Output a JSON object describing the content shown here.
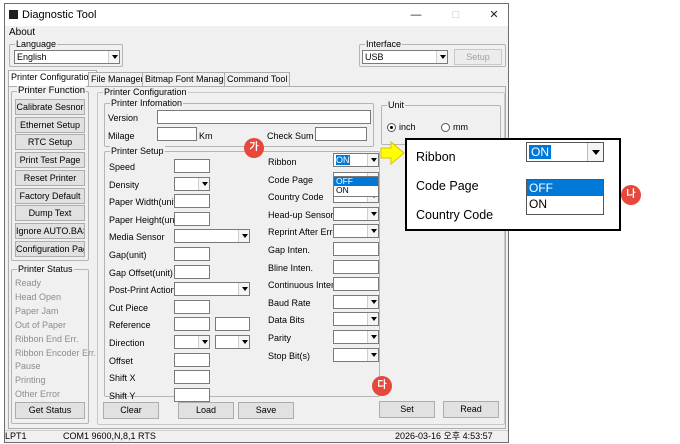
{
  "window": {
    "title": "Diagnostic Tool",
    "controls": {
      "minimize": "—",
      "maximize": "□",
      "close": "✕"
    }
  },
  "menu": {
    "about": "About"
  },
  "language": {
    "label": "Language",
    "value": "English"
  },
  "interface": {
    "label": "Interface",
    "value": "USB",
    "setup_button": "Setup"
  },
  "tabs": [
    "Printer Configuration",
    "File Manager",
    "Bitmap Font Manager",
    "Command Tool"
  ],
  "printer_function": {
    "label": "Printer Function",
    "buttons": [
      "Calibrate Sesnor",
      "Ethernet Setup",
      "RTC Setup",
      "Print Test Page",
      "Reset Printer",
      "Factory Default",
      "Dump Text",
      "Ignore AUTO.BAS",
      "Configuration Page"
    ]
  },
  "printer_status": {
    "label": "Printer Status",
    "items": [
      "Ready",
      "Head Open",
      "Paper Jam",
      "Out of Paper",
      "Ribbon End Err.",
      "Ribbon Encoder Err.",
      "Pause",
      "Printing",
      "Other Error"
    ],
    "get_status_button": "Get Status"
  },
  "printer_config": {
    "label": "Printer Configuration",
    "info": {
      "label": "Printer Infomation",
      "version": "Version",
      "milage": "Milage",
      "km": "Km",
      "check_sum": "Check Sum"
    },
    "unit": {
      "label": "Unit",
      "inch": "inch",
      "mm": "mm"
    },
    "setup": {
      "label": "Printer Setup",
      "left_fields": [
        "Speed",
        "Density",
        "Paper Width(unit)",
        "Paper Height(unit)",
        "Media Sensor",
        "Gap(unit)",
        "Gap Offset(unit)",
        "Post-Print Action",
        "Cut Piece",
        "Reference",
        "Direction",
        "Offset",
        "Shift X",
        "Shift Y"
      ],
      "right_fields": [
        "Ribbon",
        "Code Page",
        "Country Code",
        "Head-up Sensor",
        "Reprint After Error",
        "Gap Inten.",
        "Bline Inten.",
        "Continuous Inten.",
        "Baud Rate",
        "Data Bits",
        "Parity",
        "Stop Bit(s)"
      ],
      "ribbon_value": "ON",
      "ribbon_options": [
        "OFF",
        "ON"
      ]
    },
    "buttons": {
      "clear": "Clear",
      "load": "Load",
      "save": "Save",
      "set": "Set",
      "read": "Read"
    }
  },
  "statusbar": {
    "port": "LPT1",
    "com": "COM1 9600,N,8,1 RTS",
    "datetime": "2026-03-16 오후 4:53:57"
  },
  "callout": {
    "ribbon_label": "Ribbon",
    "ribbon_value": "ON",
    "code_page_label": "Code Page",
    "country_code_label": "Country Code",
    "options": [
      "OFF",
      "ON"
    ]
  },
  "badges": {
    "ga": "가",
    "na": "나",
    "da": "다"
  },
  "colors": {
    "selection": "#0078d7",
    "badge": "#e8473b",
    "arrow": "#ffff00"
  }
}
